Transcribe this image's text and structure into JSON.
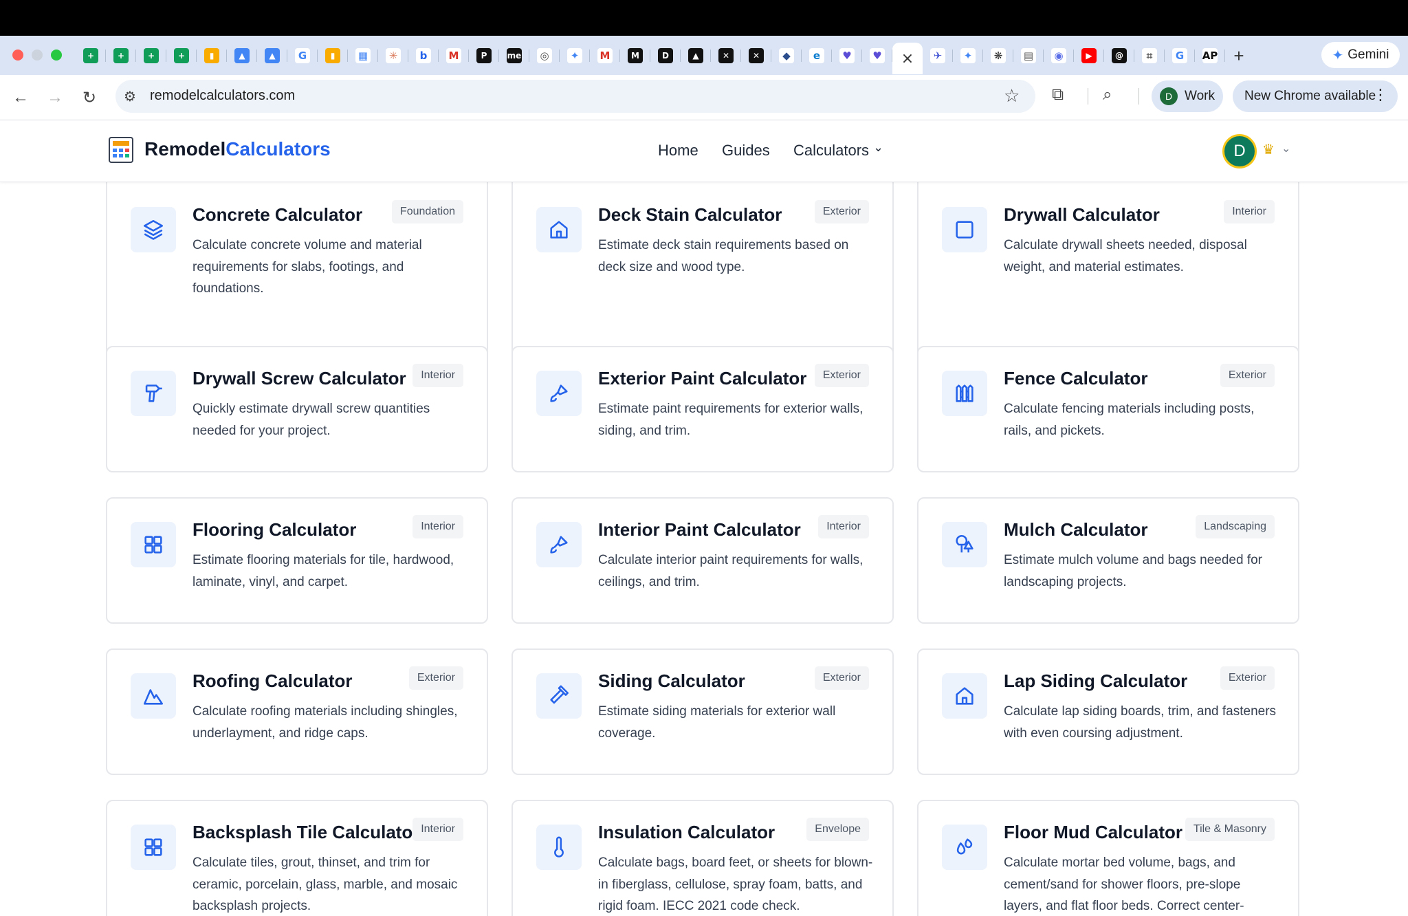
{
  "browser": {
    "tab_icons": [
      "sheets-icon",
      "sheets-icon",
      "sheets-icon",
      "sheets-icon",
      "analytics-icon",
      "ads-icon",
      "ads-icon",
      "google-icon",
      "analytics-icon",
      "calendar-icon",
      "asterisk-icon",
      "bing-icon",
      "gmail-icon",
      "product-hunt-icon",
      "medium-me-icon",
      "globe-icon",
      "gemini-icon",
      "gmail-icon",
      "medium-icon",
      "dev-icon",
      "arc-icon",
      "capcut-icon",
      "capcut-icon",
      "shield-icon",
      "edge-icon",
      "dash-icon",
      "dash-icon",
      "close-icon",
      "bird-icon",
      "gemini-icon",
      "openai-icon",
      "table-icon",
      "messenger-icon",
      "youtube-icon",
      "threads-icon",
      "bracket-icon",
      "google-icon",
      "ap-icon"
    ],
    "active_tab_index": 27,
    "gemini_label": "Gemini",
    "url": "remodelcalculators.com",
    "profile_initial": "D",
    "profile_label": "Work",
    "update_label": "New Chrome available"
  },
  "site": {
    "logo_part1": "Remodel",
    "logo_part2": "Calculators",
    "nav": {
      "home": "Home",
      "guides": "Guides",
      "calculators": "Calculators"
    },
    "user_initial": "D"
  },
  "calculators": [
    {
      "title": "Concrete Calculator",
      "badge": "Foundation",
      "desc": "Calculate concrete volume and material requirements for slabs, footings, and foundations.",
      "icon": "layers-icon"
    },
    {
      "title": "Deck Stain Calculator",
      "badge": "Exterior",
      "desc": "Estimate deck stain requirements based on deck size and wood type.",
      "icon": "home-icon"
    },
    {
      "title": "Drywall Calculator",
      "badge": "Interior",
      "desc": "Calculate drywall sheets needed, disposal weight, and material estimates.",
      "icon": "square-icon"
    },
    {
      "title": "Drywall Screw Calculator",
      "badge": "Interior",
      "desc": "Quickly estimate drywall screw quantities needed for your project.",
      "icon": "drill-icon"
    },
    {
      "title": "Exterior Paint Calculator",
      "badge": "Exterior",
      "desc": "Estimate paint requirements for exterior walls, siding, and trim.",
      "icon": "paintbrush-icon"
    },
    {
      "title": "Fence Calculator",
      "badge": "Exterior",
      "desc": "Calculate fencing materials including posts, rails, and pickets.",
      "icon": "fence-icon"
    },
    {
      "title": "Flooring Calculator",
      "badge": "Interior",
      "desc": "Estimate flooring materials for tile, hardwood, laminate, vinyl, and carpet.",
      "icon": "grid-icon"
    },
    {
      "title": "Interior Paint Calculator",
      "badge": "Interior",
      "desc": "Calculate interior paint requirements for walls, ceilings, and trim.",
      "icon": "paintbrush-icon"
    },
    {
      "title": "Mulch Calculator",
      "badge": "Landscaping",
      "desc": "Estimate mulch volume and bags needed for landscaping projects.",
      "icon": "trees-icon"
    },
    {
      "title": "Roofing Calculator",
      "badge": "Exterior",
      "desc": "Calculate roofing materials including shingles, underlayment, and ridge caps.",
      "icon": "mountain-icon"
    },
    {
      "title": "Siding Calculator",
      "badge": "Exterior",
      "desc": "Estimate siding materials for exterior wall coverage.",
      "icon": "hammer-icon"
    },
    {
      "title": "Lap Siding Calculator",
      "badge": "Exterior",
      "desc": "Calculate lap siding boards, trim, and fasteners with even coursing adjustment.",
      "icon": "home-icon"
    },
    {
      "title": "Backsplash Tile Calculator",
      "badge": "Interior",
      "desc": "Calculate tiles, grout, thinset, and trim for ceramic, porcelain, glass, marble, and mosaic backsplash projects.",
      "icon": "grid-icon"
    },
    {
      "title": "Insulation Calculator",
      "badge": "Envelope",
      "desc": "Calculate bags, board feet, or sheets for blown-in fiberglass, cellulose, spray foam, batts, and rigid foam. IECC 2021 code check.",
      "icon": "thermometer-icon"
    },
    {
      "title": "Floor Mud Calculator",
      "badge": "Tile & Masonry",
      "desc": "Calculate mortar bed volume, bags, and cement/sand for shower floors, pre-slope layers, and flat floor beds. Correct center-",
      "icon": "droplets-icon"
    }
  ],
  "colors": {
    "accent": "#2563eb",
    "icon_bg": "#edf3fc",
    "badge_bg": "#f3f4f6"
  }
}
